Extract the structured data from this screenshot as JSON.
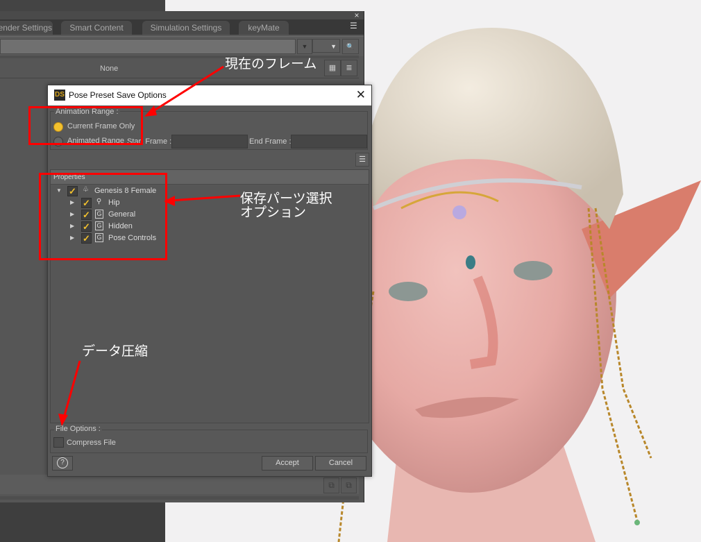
{
  "background_pane": {
    "tabs": [
      "Render Settings",
      "Smart Content",
      "Simulation Settings",
      "keyMate"
    ],
    "list_header_value": "None",
    "close_glyph": "×",
    "menu_icon": "panel-menu-icon",
    "search_icon": "search-icon",
    "view_icons": [
      "grid-view-icon",
      "list-view-icon"
    ],
    "bottom_icons": [
      "copy-icon",
      "paste-icon"
    ]
  },
  "dialog": {
    "logo": "DS",
    "title": "Pose Preset Save Options",
    "close_glyph": "✕",
    "animation_range": {
      "legend": "Animation Range :",
      "options": [
        {
          "label": "Current Frame Only",
          "selected": true
        },
        {
          "label": "Animated Range",
          "selected": false
        }
      ],
      "start_frame_label": "Start Frame :",
      "start_frame_value": "",
      "end_frame_label": "End Frame :",
      "end_frame_value": ""
    },
    "properties": {
      "header": "Properties",
      "tree": [
        {
          "label": "Genesis 8 Female",
          "checked": true,
          "expanded": true,
          "icon": "figure-icon",
          "level": 0
        },
        {
          "label": "Hip",
          "checked": true,
          "expanded": false,
          "icon": "bone-icon",
          "level": 1
        },
        {
          "label": "General",
          "checked": true,
          "expanded": false,
          "icon": "group-icon",
          "level": 1
        },
        {
          "label": "Hidden",
          "checked": true,
          "expanded": false,
          "icon": "group-icon",
          "level": 1
        },
        {
          "label": "Pose Controls",
          "checked": true,
          "expanded": false,
          "icon": "group-icon",
          "level": 1
        }
      ]
    },
    "file_options": {
      "legend": "File Options :",
      "compress_label": "Compress File",
      "compress_checked": false
    },
    "buttons": {
      "help": "?",
      "accept": "Accept",
      "cancel": "Cancel"
    }
  },
  "annotations": [
    {
      "text": "現在のフレーム",
      "target": "animation-range"
    },
    {
      "text": "保存パーツ選択",
      "text2": "オプション",
      "target": "properties-tree"
    },
    {
      "text": "データ圧縮",
      "target": "compress-file"
    }
  ],
  "colors": {
    "accent_yellow": "#f2c12e",
    "annotation_red": "#ff0000",
    "dialog_bg": "#585858"
  }
}
